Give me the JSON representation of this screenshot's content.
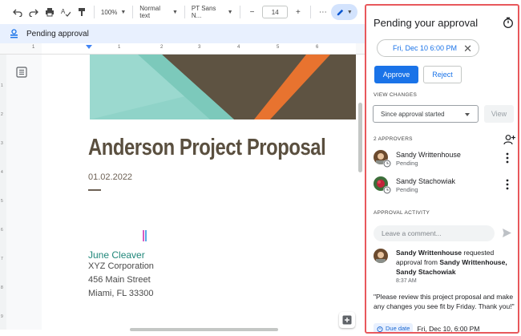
{
  "toolbar": {
    "zoom": "100%",
    "style": "Normal text",
    "font": "PT Sans N...",
    "font_size": "14",
    "more": "⋯",
    "icons": [
      "undo-icon",
      "redo-icon",
      "print-icon",
      "spellcheck-icon",
      "paint-format-icon",
      "edit-pencil-icon"
    ]
  },
  "banner": {
    "label": "Pending approval"
  },
  "ruler": {
    "h_numbers": [
      "1",
      "1",
      "2",
      "3",
      "4",
      "5",
      "6"
    ],
    "v_numbers": [
      "1",
      "2",
      "3",
      "4",
      "5",
      "6",
      "7",
      "8",
      "9"
    ]
  },
  "document": {
    "title": "Anderson Project Proposal",
    "date": "01.02.2022",
    "contact_name": "June Cleaver",
    "address_lines": [
      "XYZ Corporation",
      "456 Main Street",
      "Miami, FL 33300"
    ],
    "hero_colors": {
      "teal": "#8fd3c8",
      "brown": "#5e5342",
      "orange": "#e8732f",
      "dark_teal": "#5fb8a8"
    }
  },
  "panel": {
    "title": "Pending your approval",
    "due_chip": "Fri, Dec 10 6:00 PM",
    "approve_label": "Approve",
    "reject_label": "Reject",
    "view_changes_label": "VIEW CHANGES",
    "view_changes_select": "Since approval started",
    "view_button": "View",
    "approvers_label": "2 APPROVERS",
    "approvers": [
      {
        "name": "Sandy Writtenhouse",
        "status": "Pending"
      },
      {
        "name": "Sandy Stachowiak",
        "status": "Pending"
      }
    ],
    "activity_label": "APPROVAL ACTIVITY",
    "comment_placeholder": "Leave a comment...",
    "activity": {
      "actor": "Sandy Writtenhouse",
      "verb": " requested approval from ",
      "recipients": "Sandy Writtenhouse, Sandy Stachowiak",
      "time": "8:37 AM",
      "message": "\"Please review this project proposal and make any changes you see fit by Friday. Thank you!\"",
      "due_label": "Due date",
      "due_value": "Fri, Dec 10, 6:00 PM"
    },
    "accent_color": "#1a73e8",
    "border_color": "#e8585c"
  }
}
